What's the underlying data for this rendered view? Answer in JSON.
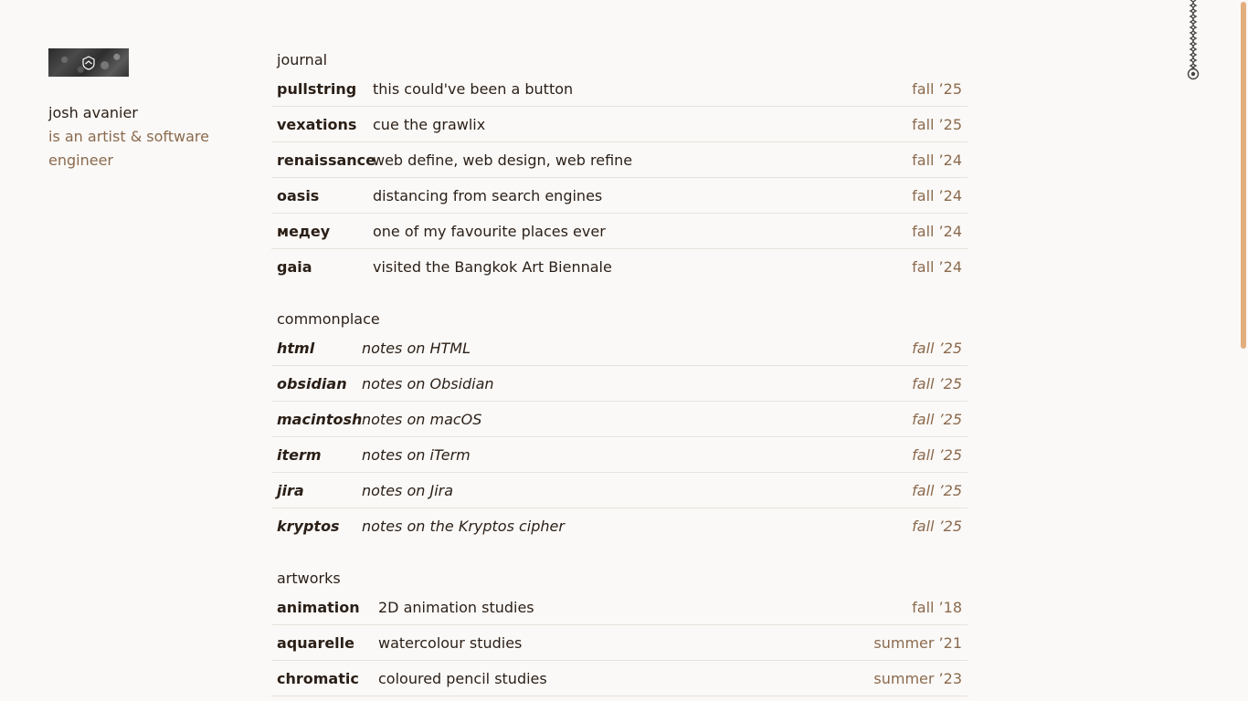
{
  "sidebar": {
    "name": "josh avanier",
    "tagline": "is an artist & software engineer"
  },
  "sections": [
    {
      "title": "journal",
      "items": [
        {
          "title": "pullstring",
          "desc": "this could've been a button",
          "date": "fall ’25"
        },
        {
          "title": "vexations",
          "desc": "cue the grawlix",
          "date": "fall ’25"
        },
        {
          "title": "renaissance",
          "desc": "web define, web design, web refine",
          "date": "fall ’24"
        },
        {
          "title": "oasis",
          "desc": "distancing from search engines",
          "date": "fall ’24"
        },
        {
          "title": "медеу",
          "desc": "one of my favourite places ever",
          "date": "fall ’24"
        },
        {
          "title": "gaia",
          "desc": "visited the Bangkok Art Biennale",
          "date": "fall ’24"
        }
      ]
    },
    {
      "title": "commonplace",
      "items": [
        {
          "title": "html",
          "desc": "notes on HTML",
          "date": "fall ’25"
        },
        {
          "title": "obsidian",
          "desc": "notes on Obsidian",
          "date": "fall ’25"
        },
        {
          "title": "macintosh",
          "desc": "notes on macOS",
          "date": "fall ’25"
        },
        {
          "title": "iterm",
          "desc": "notes on iTerm",
          "date": "fall ’25"
        },
        {
          "title": "jira",
          "desc": "notes on Jira",
          "date": "fall ’25"
        },
        {
          "title": "kryptos",
          "desc": "notes on the Kryptos cipher",
          "date": "fall ’25"
        }
      ]
    },
    {
      "title": "artworks",
      "items": [
        {
          "title": "animation",
          "desc": "2D animation studies",
          "date": "fall ’18"
        },
        {
          "title": "aquarelle",
          "desc": "watercolour studies",
          "date": "summer ’21"
        },
        {
          "title": "chromatic",
          "desc": "coloured pencil studies",
          "date": "summer ’23"
        }
      ]
    }
  ],
  "icons": {
    "logo": "shield-logo-icon",
    "pullstring": "pullstring-icon"
  },
  "colors": {
    "background": "#fbf9f7",
    "text": "#2a1f17",
    "muted": "#8a6a4e",
    "divider": "#e7e2dc",
    "scrollbar": "#e2ae7e"
  }
}
